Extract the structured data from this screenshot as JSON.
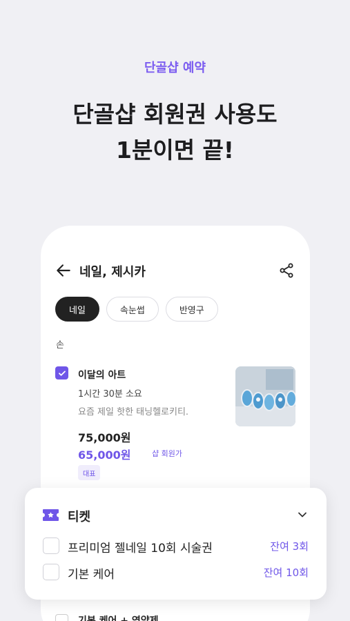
{
  "intro": {
    "eyebrow": "단골샵 예약",
    "headline_line1": "단골샵 회원권 사용도",
    "headline_line2": "1분이면 끝!"
  },
  "shop": {
    "title": "네일, 제시카"
  },
  "categories": [
    {
      "label": "네일",
      "active": true
    },
    {
      "label": "속눈썹",
      "active": false
    },
    {
      "label": "반영구",
      "active": false
    }
  ],
  "section": {
    "label": "손"
  },
  "item": {
    "checked": true,
    "title": "이달의 아트",
    "duration": "1시간 30분 소요",
    "description": "요즘 제일 핫한 태닝헬로키티.",
    "price": "75,000원",
    "member_price": "65,000원",
    "member_label": "샵 회원가",
    "badge": "대표"
  },
  "next_item": {
    "title": "기본 케어 + 영양제"
  },
  "ticket": {
    "title": "티켓",
    "rows": [
      {
        "name": "프리미엄 젤네일 10회 시술권",
        "remaining": "잔여 3회"
      },
      {
        "name": "기본 케어",
        "remaining": "잔여 10회"
      }
    ]
  },
  "colors": {
    "accent": "#6f56e8",
    "background": "#f0f0f4",
    "chip_active": "#222222"
  }
}
